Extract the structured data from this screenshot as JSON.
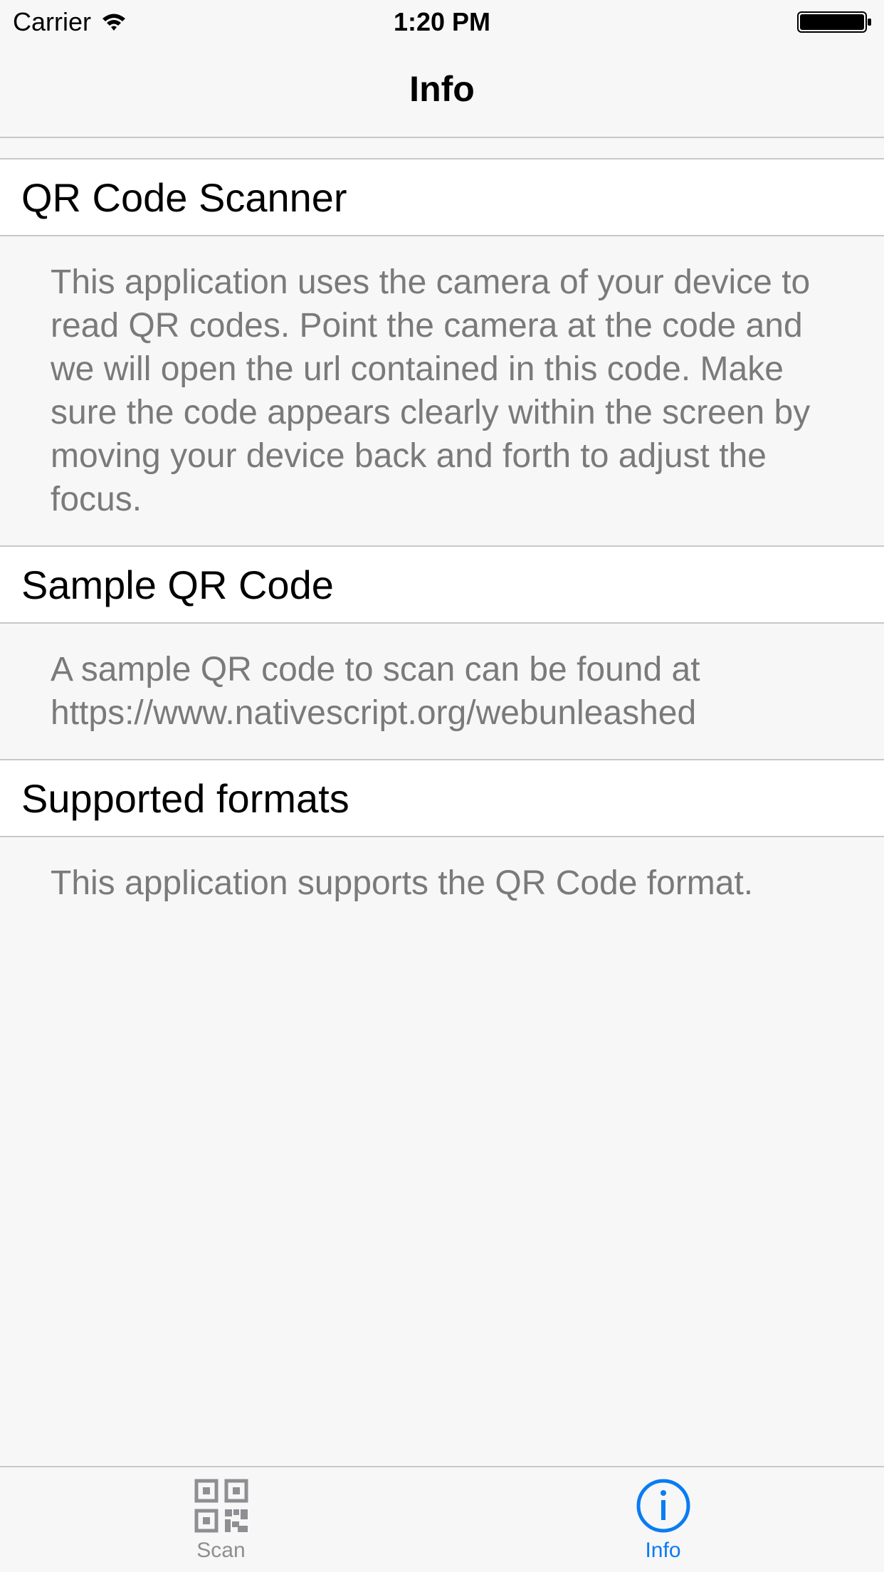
{
  "status_bar": {
    "carrier": "Carrier",
    "time": "1:20 PM"
  },
  "nav": {
    "title": "Info"
  },
  "sections": [
    {
      "header": "QR Code Scanner",
      "body": "This application uses the camera of your device to read QR codes. Point the camera at the code and we will open the url contained in this code. Make sure the code appears clearly within the screen by moving your device back and forth to adjust the focus."
    },
    {
      "header": "Sample QR Code",
      "body": "A sample QR code to scan can be found at https://www.nativescript.org/webunleashed"
    },
    {
      "header": "Supported formats",
      "body": "This application supports the QR Code format."
    }
  ],
  "tabs": [
    {
      "label": "Scan",
      "icon": "qr-code-icon",
      "selected": false
    },
    {
      "label": "Info",
      "icon": "info-icon",
      "selected": true
    }
  ],
  "colors": {
    "accent": "#0a7cf3",
    "inactive": "#8e8e93",
    "body_text": "#7a7a7a",
    "background": "#f7f7f7"
  }
}
